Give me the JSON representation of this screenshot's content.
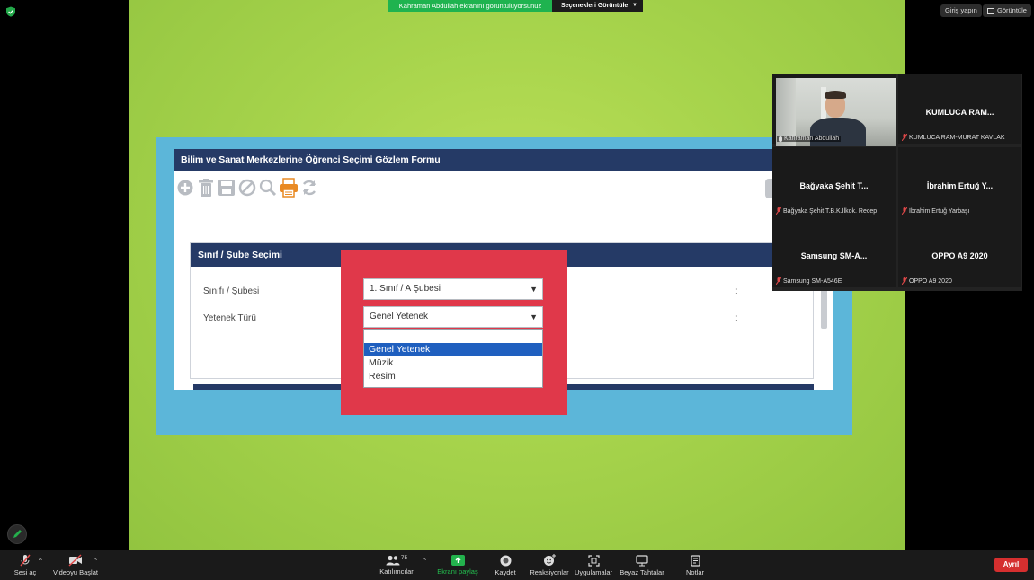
{
  "banner": {
    "text": "Kahraman Abdullah ekranını görüntülüyorsunuz",
    "options_label": "Seçenekleri Görüntüle"
  },
  "top_right": {
    "signin": "Giriş yapın",
    "view": "Görüntüle"
  },
  "shared_screen": {
    "form_title": "Bilim ve Sanat Merkezlerine Öğrenci Seçimi Gözlem Formu",
    "section_title": "Sınıf / Şube Seçimi",
    "fields": [
      {
        "label": "Sınıfı / Şubesi",
        "value": "1. Sınıf / A Şubesi",
        "colon": ":"
      },
      {
        "label": "Yetenek Türü",
        "value": "Genel Yetenek",
        "colon": ":"
      }
    ],
    "dropdown_options": [
      "Genel Yetenek",
      "Müzik",
      "Resim"
    ],
    "selected_option": "Genel Yetenek"
  },
  "participants": [
    {
      "display": "",
      "caption": "Kahraman Abdullah",
      "video": true
    },
    {
      "display": "KUMLUCA RAM...",
      "caption": "KUMLUCA RAM-MURAT KAVLAK"
    },
    {
      "display": "Bağyaka Şehit T...",
      "caption": "Bağyaka Şehit T.B.K.İlkok. Recep"
    },
    {
      "display": "İbrahim Ertuğ Y...",
      "caption": "İbrahim Ertuğ Yarbaşı"
    },
    {
      "display": "Samsung  SM-A...",
      "caption": "Samsung SM-A546E"
    },
    {
      "display": "OPPO A9 2020",
      "caption": "OPPO A9 2020"
    }
  ],
  "toolbar": {
    "audio": "Sesi aç",
    "video": "Videoyu Başlat",
    "participants": "Katılımcılar",
    "participant_count": "75",
    "share": "Ekranı paylaş",
    "record": "Kaydet",
    "reactions": "Reaksiyonlar",
    "apps": "Uygulamalar",
    "whiteboard": "Beyaz Tahtalar",
    "notes": "Notlar",
    "leave": "Ayrıl"
  },
  "colors": {
    "accent_green": "#1fb34f",
    "leave_red": "#d52f2f",
    "form_navy": "#253a66",
    "highlight_red": "#e0384a"
  }
}
